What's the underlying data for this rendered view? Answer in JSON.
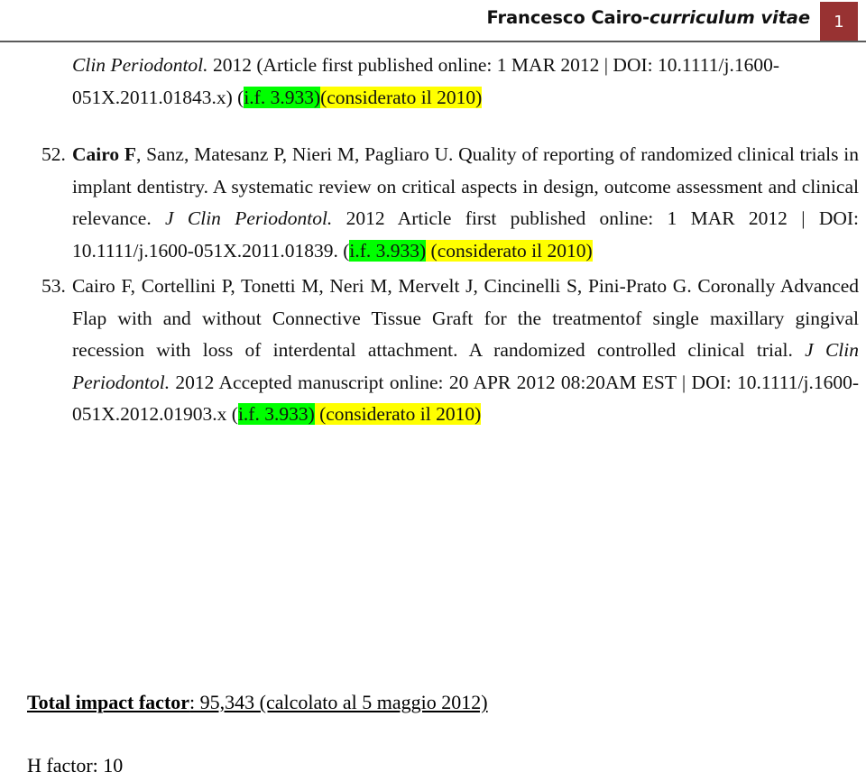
{
  "header": {
    "title_plain": "Francesco Cairo-",
    "title_italic": "curriculum vitae",
    "page_number": "1",
    "accent_color": "#983232",
    "rule_color": "#5a5a5a"
  },
  "highlight_colors": {
    "impact_factor": "#00ff00",
    "year_note": "#ffff00"
  },
  "lead_paragraph": {
    "journal_italic": "Clin Periodontol.",
    "rest": " 2012  (Article first published online: 1 MAR 2012 | DOI: 10.1111/j.1600-051X.2011.01843.x) (",
    "impact_factor": "i.f. 3.933)",
    "year_note": "(considerato il 2010)"
  },
  "references": [
    {
      "number": "52.",
      "authors_bold": "Cairo F",
      "authors_rest": ", Sanz, Matesanz P, Nieri M, Pagliaro U.",
      "title": " Quality of reporting of randomized clinical trials in implant dentistry. A systematic review on critical aspects in design, outcome assessment and clinical relevance. ",
      "journal_italic": "J Clin Periodontol.",
      "details": " 2012   Article first published online: 1 MAR 2012 | DOI: 10.1111/j.1600-051X.2011.01839. (",
      "impact_factor": "i.f. 3.933)",
      "year_note": " (considerato il 2010)"
    },
    {
      "number": "53.",
      "authors_bold": "",
      "authors_rest": "Cairo F, Cortellini P, Tonetti M, Neri M, Mervelt J, Cincinelli S, Pini-Prato G.",
      "title": " Coronally Advanced Flap with and without Connective Tissue Graft for the treatmentof single maxillary gingival recession with loss of interdental attachment. A randomized controlled clinical trial. ",
      "journal_italic": "J Clin Periodontol.",
      "details": " 2012  Accepted manuscript online: 20 APR 2012 08:20AM EST | DOI: 10.1111/j.1600-051X.2012.01903.x (",
      "impact_factor": "i.f. 3.933)",
      "year_note": " (considerato il 2010)"
    }
  ],
  "totals": {
    "total_impact_factor_label": "Total impact factor",
    "total_impact_factor_value": ": 95,343 (calcolato al 5 maggio 2012)",
    "h_factor": "H factor: 10"
  }
}
